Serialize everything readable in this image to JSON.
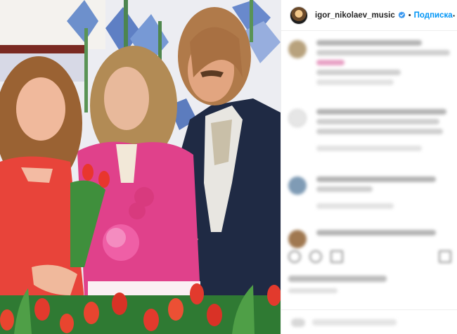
{
  "post": {
    "username": "igor_nikolaev_music",
    "separator": "•",
    "follow_label": "Подписка",
    "more_label": "···"
  },
  "icons": {
    "verified": "verified-badge-icon",
    "more": "more-options-icon",
    "like": "heart-icon",
    "comment": "comment-icon",
    "share": "share-icon",
    "save": "bookmark-icon"
  },
  "colors": {
    "accent": "#0095f6",
    "text": "#262626",
    "border": "#efefef"
  }
}
